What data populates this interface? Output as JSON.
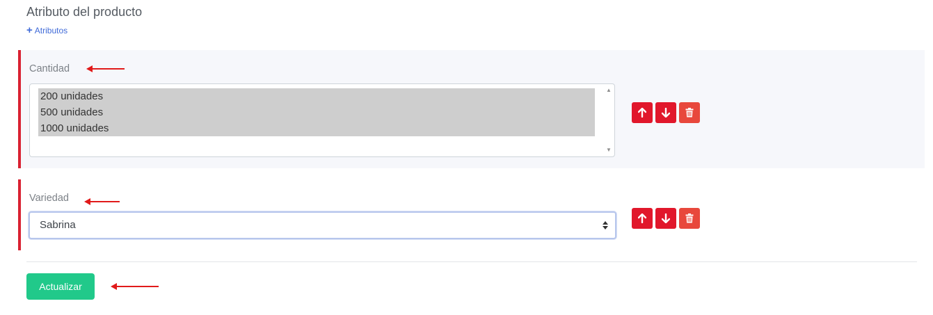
{
  "section": {
    "title": "Atributo del producto",
    "add_link": "Atributos"
  },
  "attributes": [
    {
      "label": "Cantidad",
      "options": [
        "200 unidades",
        "500 unidades",
        "1000 unidades"
      ]
    },
    {
      "label": "Variedad",
      "selected": "Sabrina"
    }
  ],
  "icons": {
    "move_up": "arrow-up-icon",
    "move_down": "arrow-down-icon",
    "delete": "trash-icon"
  },
  "colors": {
    "accent_border": "#d92232",
    "button_red": "#e1172b",
    "button_delete": "#e8483c",
    "button_success": "#21c98a",
    "link": "#3f6ad8"
  },
  "footer": {
    "update_label": "Actualizar"
  }
}
